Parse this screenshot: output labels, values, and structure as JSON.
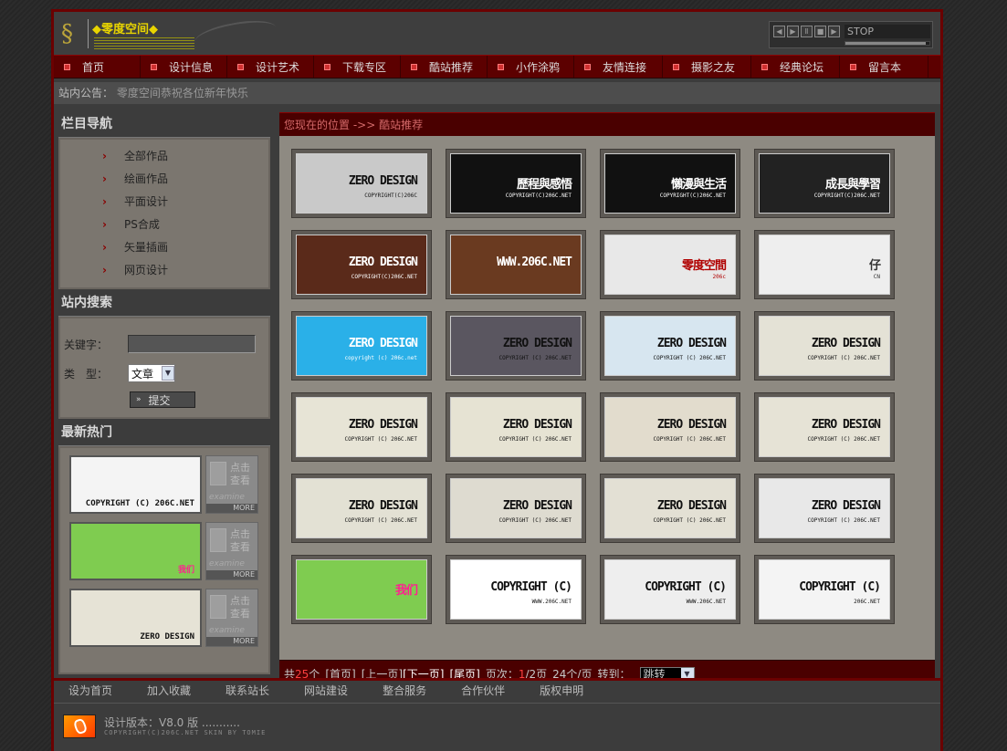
{
  "header": {
    "title": "◆零度空间◆",
    "player": {
      "status": "STOP",
      "volume": 0.96
    }
  },
  "nav": [
    "首页",
    "设计信息",
    "设计艺术",
    "下载专区",
    "酷站推荐",
    "小作涂鸦",
    "友情连接",
    "摄影之友",
    "经典论坛",
    "留言本"
  ],
  "notice": {
    "label": "站内公告：",
    "text": "零度空间恭祝各位新年快乐"
  },
  "sidebar": {
    "category_title": "栏目导航",
    "categories": [
      "全部作品",
      "绘画作品",
      "平面设计",
      "PS合成",
      "矢量插画",
      "网页设计"
    ],
    "search_title": "站内搜索",
    "keyword_label": "关键字：",
    "type_label": "类　型：",
    "type_value": "文章",
    "submit_label": "提交",
    "hot_title": "最新热门",
    "hot_more_text": "点击查看",
    "hot_more_sub": "examine",
    "hot_more_btn": "MORE",
    "hot_captions": [
      "COPYRIGHT (C) 206C.NET",
      "我们",
      "ZERO DESIGN"
    ]
  },
  "main": {
    "breadcrumb": "您现在的位置 ->> 酷站推荐",
    "cards": [
      {
        "title": "ZERO DESIGN",
        "sub": "COPYRIGHT(C)206C",
        "bg": "#c9c9c9",
        "fg": "#111"
      },
      {
        "title": "歷程與感悟",
        "sub": "COPYRIGHT(C)206C.NET",
        "bg": "#111111",
        "fg": "#ffffff"
      },
      {
        "title": "懶漫與生活",
        "sub": "COPYRIGHT(C)206C.NET",
        "bg": "#111111",
        "fg": "#ffffff"
      },
      {
        "title": "成長與學習",
        "sub": "COPYRIGHT(C)206C.NET",
        "bg": "#222222",
        "fg": "#ffffff"
      },
      {
        "title": "ZERO DESIGN",
        "sub": "COPYRIGHT(C)206C.NET",
        "bg": "#5a2a1a",
        "fg": "#ffffff"
      },
      {
        "title": "WWW.206C.NET",
        "sub": "",
        "bg": "#6a3a20",
        "fg": "#ffffff"
      },
      {
        "title": "零度空間",
        "sub": "206c",
        "bg": "#e8e8e8",
        "fg": "#b00000"
      },
      {
        "title": "仔",
        "sub": "CN",
        "bg": "#eeeeee",
        "fg": "#333333"
      },
      {
        "title": "ZERO DESIGN",
        "sub": "copyright (c) 206c.net",
        "bg": "#2ab0e8",
        "fg": "#ffffff"
      },
      {
        "title": "ZERO DESIGN",
        "sub": "COPYRIGHT (C) 206C.NET",
        "bg": "#5a5660",
        "fg": "#111111"
      },
      {
        "title": "ZERO DESIGN",
        "sub": "COPYRIGHT (C) 206C.NET",
        "bg": "#d7e6f0",
        "fg": "#111111"
      },
      {
        "title": "ZERO DESIGN",
        "sub": "COPYRIGHT (C) 206C.NET",
        "bg": "#e4e2d6",
        "fg": "#111111"
      },
      {
        "title": "ZERO DESIGN",
        "sub": "COPYRIGHT (C) 206C.NET",
        "bg": "#e7e4d6",
        "fg": "#111111"
      },
      {
        "title": "ZERO DESIGN",
        "sub": "COPYRIGHT (C) 206C.NET",
        "bg": "#e6e3d3",
        "fg": "#111111"
      },
      {
        "title": "ZERO DESIGN",
        "sub": "COPYRIGHT (C) 206C.NET",
        "bg": "#e2dccd",
        "fg": "#111111"
      },
      {
        "title": "ZERO DESIGN",
        "sub": "COPYRIGHT (C) 206C.NET",
        "bg": "#e6e3d6",
        "fg": "#111111"
      },
      {
        "title": "ZERO DESIGN",
        "sub": "COPYRIGHT (C) 206C.NET",
        "bg": "#e3e1d4",
        "fg": "#111111"
      },
      {
        "title": "ZERO DESIGN",
        "sub": "COPYRIGHT (C) 206C.NET",
        "bg": "#dedbd0",
        "fg": "#111111"
      },
      {
        "title": "ZERO DESIGN",
        "sub": "COPYRIGHT (C) 206C.NET",
        "bg": "#e3e0d4",
        "fg": "#111111"
      },
      {
        "title": "ZERO DESIGN",
        "sub": "COPYRIGHT (C) 206C.NET",
        "bg": "#e8e8e8",
        "fg": "#111111"
      },
      {
        "title": "我们",
        "sub": "",
        "bg": "#7fcc50",
        "fg": "#ff2090"
      },
      {
        "title": "COPYRIGHT (C)",
        "sub": "WWW.206C.NET",
        "bg": "#ffffff",
        "fg": "#111111"
      },
      {
        "title": "COPYRIGHT (C)",
        "sub": "WWW.206C.NET",
        "bg": "#eeeeee",
        "fg": "#111111"
      },
      {
        "title": "COPYRIGHT (C)",
        "sub": "206C.NET",
        "bg": "#f4f4f4",
        "fg": "#111111"
      }
    ]
  },
  "pager": {
    "total_prefix": "共",
    "total": "25",
    "total_suffix": "个",
    "first": "[首页]",
    "prev": "[上一页]",
    "next": "[下一页]",
    "last": "[尾页]",
    "page_label": "页次：",
    "page_cur": "1",
    "page_total": "/2页",
    "per_page": "24个/页",
    "goto_label": "转到：",
    "goto_value": "跳转"
  },
  "footer": {
    "links": [
      "设为首页",
      "加入收藏",
      "联系站长",
      "网站建设",
      "整合服务",
      "合作伙伴",
      "版权申明"
    ],
    "version": "设计版本：V8.0 版 ...........",
    "copyright": "COPYRIGHT(C)206C.NET SKIN BY TOMIE"
  },
  "colors": {
    "accent": "#6b0000",
    "nav_bg": "#5c0000",
    "panel": "#7b766f"
  }
}
